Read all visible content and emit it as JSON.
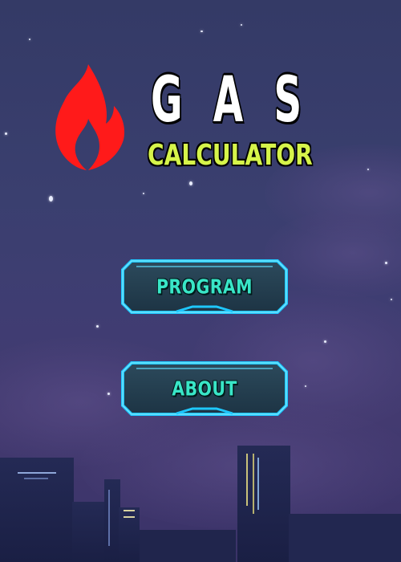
{
  "app": {
    "title_main": "G A S",
    "title_sub": "CALCULATOR"
  },
  "menu": {
    "program_label": "PROGRAM",
    "about_label": "ABOUT"
  },
  "colors": {
    "title_main": "#ffffff",
    "title_sub": "#d6f44a",
    "button_text": "#39e6c7",
    "button_glow": "#1ec8ff",
    "flame": "#ff1a1a",
    "sky_top": "#343a66",
    "sky_bottom": "#3a3268"
  },
  "icons": {
    "logo": "flame-icon"
  }
}
